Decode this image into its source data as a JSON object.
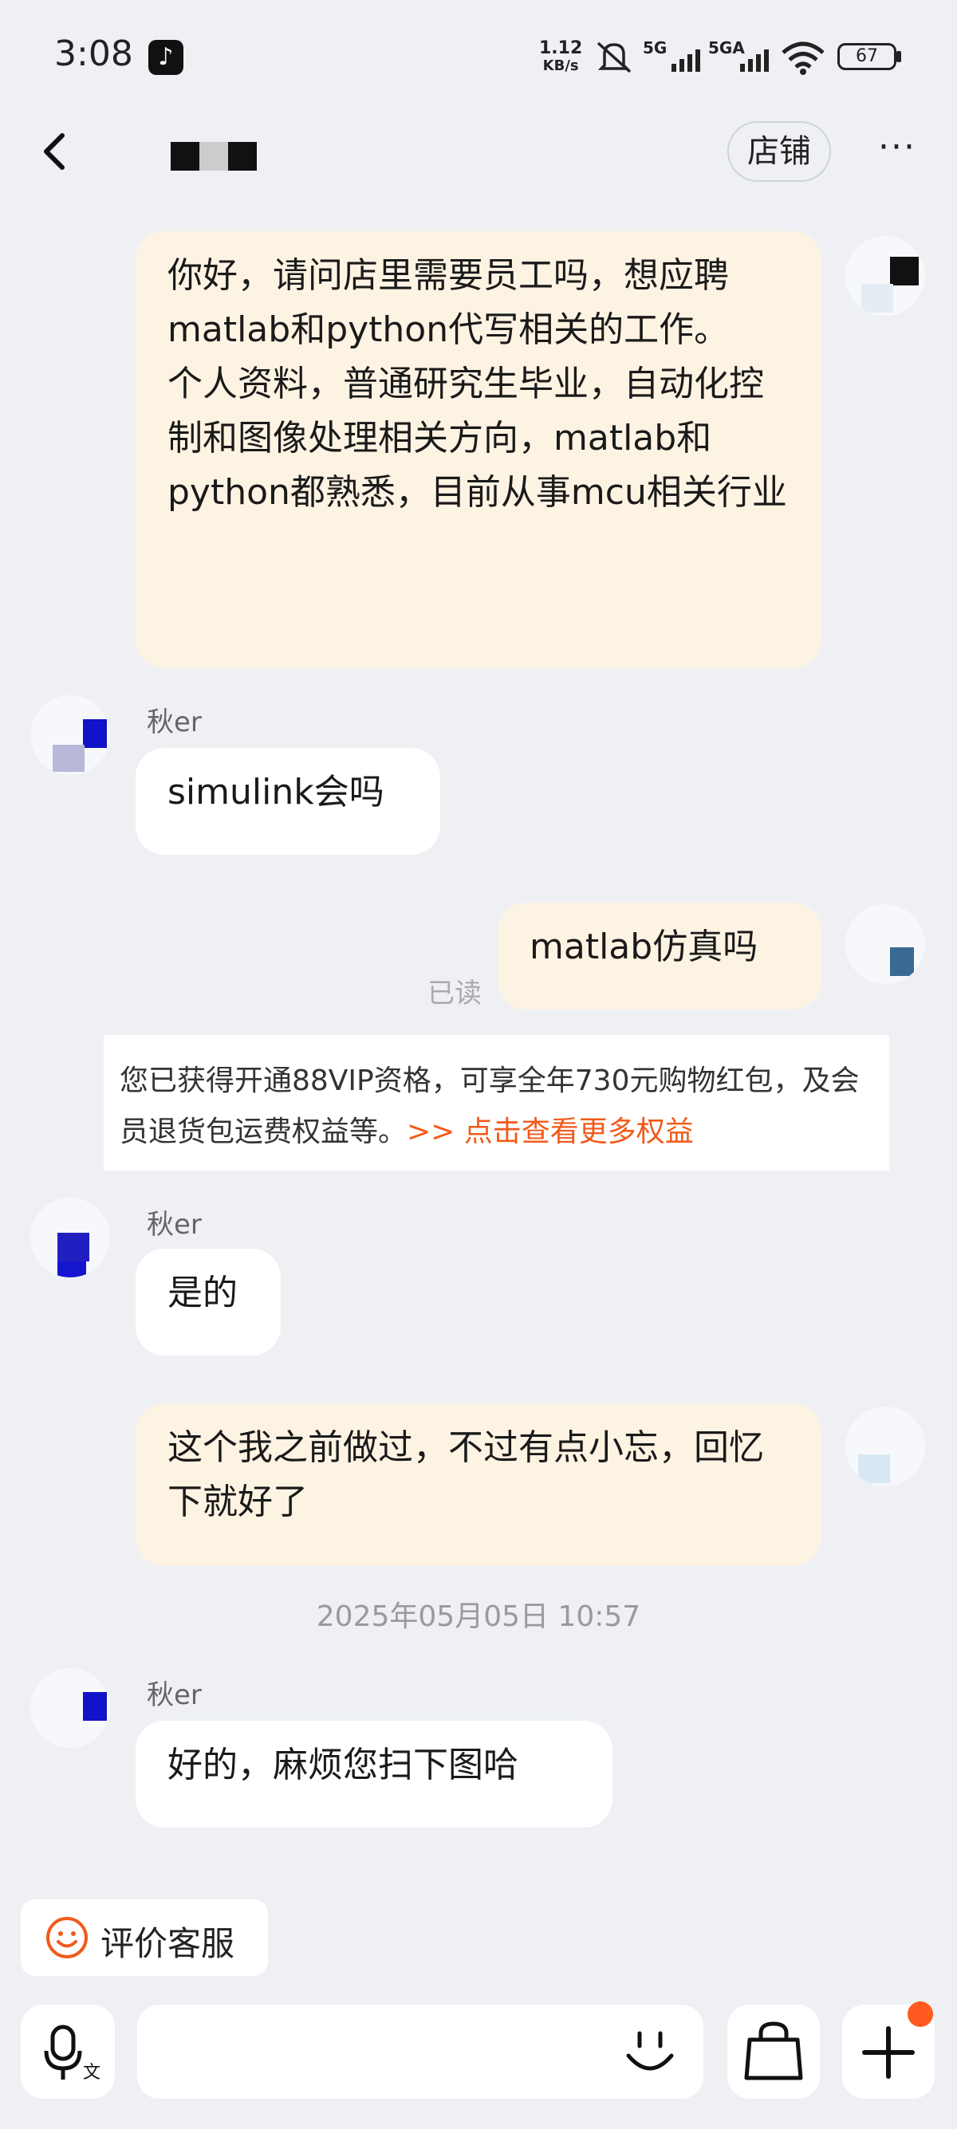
{
  "status_bar": {
    "time": "3:08",
    "net_speed_value": "1.12",
    "net_speed_unit": "KB/s",
    "signal1_label": "5G",
    "signal2_label": "5GA",
    "battery": "67"
  },
  "header": {
    "store_button": "店铺",
    "more_button": "···"
  },
  "messages": [
    {
      "from": "me",
      "text": "你好，请问店里需要员工吗，想应聘matlab和python代写相关的工作。\n个人资料，普通研究生毕业，自动化控制和图像处理相关方向，matlab和python都熟悉，目前从事mcu相关行业"
    },
    {
      "from": "them",
      "nick": "秋er",
      "text": "simulink会吗"
    },
    {
      "from": "me",
      "text": "matlab仿真吗",
      "status": "已读"
    },
    {
      "from": "them",
      "nick": "秋er",
      "text": "是的"
    },
    {
      "from": "me",
      "text": "这个我之前做过，不过有点小忘，回忆下就好了"
    },
    {
      "from": "them",
      "nick": "秋er",
      "text": "好的，麻烦您扫下图哈"
    }
  ],
  "promo": {
    "text": "您已获得开通88VIP资格，可享全年730元购物红包，及会员退货包运费权益等。",
    "link": ">> 点击查看更多权益"
  },
  "timestamp": "2025年05月05日 10:57",
  "rate_button": "评价客服",
  "colors": {
    "background": "#eef0f4",
    "my_bubble": "#fdf3e3",
    "their_bubble": "#ffffff",
    "accent": "#f25a1a",
    "notification_dot": "#ff5a1f"
  }
}
